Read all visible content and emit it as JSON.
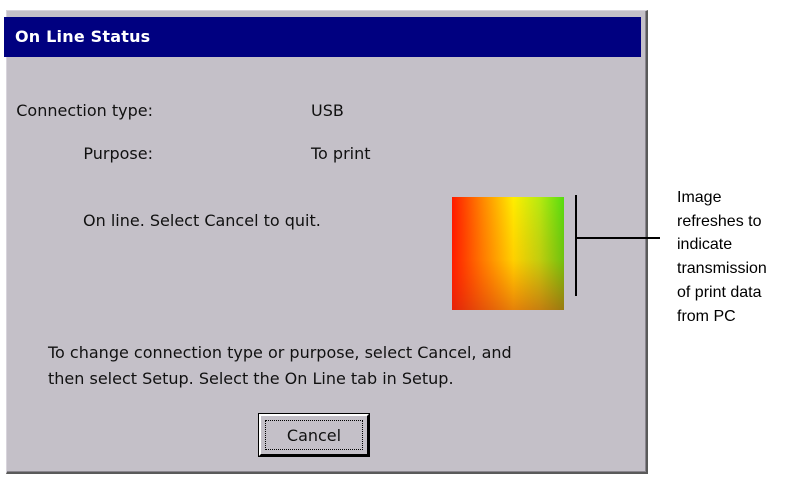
{
  "window": {
    "title": "On Line Status"
  },
  "fields": {
    "connection_type_label": "Connection type:",
    "connection_type_value": "USB",
    "purpose_label": "Purpose:",
    "purpose_value": "To print"
  },
  "status": {
    "message": "On line. Select Cancel to quit."
  },
  "hint": {
    "line1": "To change connection type or purpose, select Cancel, and",
    "line2": "then select Setup. Select the On Line tab in Setup."
  },
  "buttons": {
    "cancel_label": "Cancel"
  },
  "callout": {
    "lines": [
      "Image",
      "refreshes to",
      "indicate",
      "transmission",
      "of print data",
      "from PC"
    ]
  },
  "colors": {
    "titlebar": "#000080",
    "dialog_bg": "#c4c0c8",
    "gradient_start": "#ff1a00",
    "gradient_mid": "#ffee00",
    "gradient_end": "#55dd10"
  }
}
